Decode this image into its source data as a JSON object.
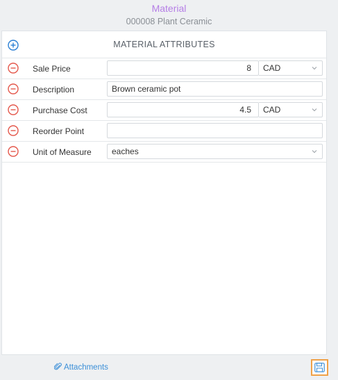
{
  "header": {
    "title": "Material",
    "subtitle": "000008 Plant Ceramic"
  },
  "panel": {
    "heading": "MATERIAL ATTRIBUTES"
  },
  "attributes": [
    {
      "label": "Sale Price",
      "value": "8",
      "currency": "CAD"
    },
    {
      "label": "Description",
      "value": "Brown ceramic pot"
    },
    {
      "label": "Purchase Cost",
      "value": "4.5",
      "currency": "CAD"
    },
    {
      "label": "Reorder Point",
      "value": ""
    },
    {
      "label": "Unit of Measure",
      "value": "eaches"
    }
  ],
  "footer": {
    "attachments_label": "Attachments"
  },
  "colors": {
    "title": "#b57ee6",
    "add_icon": "#2b7fd4",
    "remove_icon": "#e4574b",
    "save_highlight": "#f0a248",
    "link": "#3b8fd8"
  }
}
